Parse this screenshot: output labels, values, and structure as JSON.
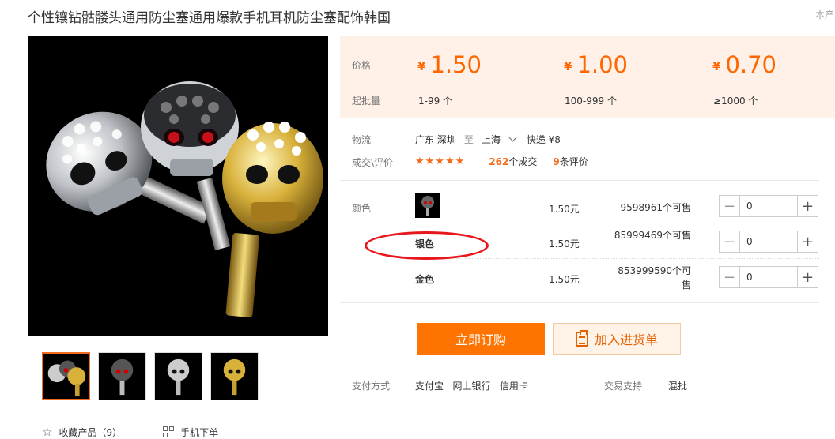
{
  "product": {
    "title": "个性镶钻骷髅头通用防尘塞通用爆款手机耳机防尘塞配饰韩国",
    "corner_note": "本产"
  },
  "price_panel": {
    "price_label": "价格",
    "moq_label": "起批量",
    "currency": "¥",
    "tiers": [
      {
        "price": "1.50",
        "moq": "1-99 个"
      },
      {
        "price": "1.00",
        "moq": "100-999 个"
      },
      {
        "price": "0.70",
        "moq": "≥1000 个"
      }
    ]
  },
  "logistics": {
    "label": "物流",
    "from": "广东 深圳",
    "to_word": "至",
    "to": "上海",
    "shipping": "快递 ¥8"
  },
  "deals": {
    "label": "成交\\评价",
    "stars": "★★★★★",
    "rating": 5,
    "deal_count": "262",
    "deal_suffix": "个成交",
    "review_count": "9",
    "review_suffix": "条评价"
  },
  "variants": {
    "label": "颜色",
    "rows": [
      {
        "name": "",
        "has_thumb": true,
        "price": "1.50元",
        "stock": "9598961个可售",
        "qty": "0"
      },
      {
        "name": "银色",
        "has_thumb": false,
        "price": "1.50元",
        "stock": "85999469个可售",
        "qty": "0"
      },
      {
        "name": "金色",
        "has_thumb": false,
        "price": "1.50元",
        "stock": "853999590个可售",
        "qty": "0"
      }
    ]
  },
  "buttons": {
    "buy": "立即订购",
    "cart": "加入进货单"
  },
  "payment": {
    "label": "支付方式",
    "methods": "支付宝   网上银行   信用卡",
    "trade_label": "交易支持",
    "trade_value": "混批"
  },
  "bottom_actions": {
    "favorite": "收藏产品（9）",
    "mobile": "手机下单"
  },
  "colors": {
    "accent": "#ff7300",
    "price": "#ff6600",
    "annotation": "#e8171d"
  },
  "icons": [
    "minus-icon",
    "plus-icon",
    "chevron-down-icon",
    "star-icon",
    "qr-icon",
    "clipboard-icon"
  ]
}
